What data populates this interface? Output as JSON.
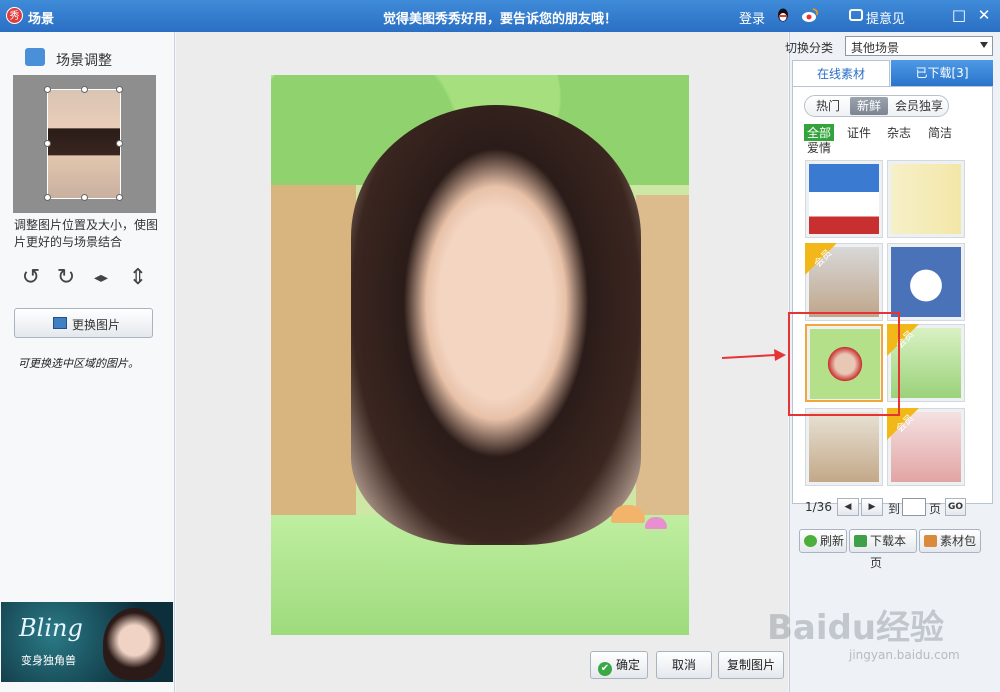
{
  "titlebar": {
    "app_logo": "秀",
    "title": "场景",
    "slogan": "觉得美图秀秀好用，要告诉您的朋友哦！",
    "login": "登录",
    "feedback": "提意见",
    "icons": [
      "qq-icon",
      "weibo-icon",
      "feedback-icon",
      "restore-icon",
      "close-icon"
    ],
    "restore_glyph": "□",
    "close_glyph": "✕"
  },
  "left_panel": {
    "title": "场景调整",
    "help_text": "调整图片位置及大小，使图片更好的与场景结合",
    "tools": [
      "rotate-left-icon",
      "rotate-right-icon",
      "flip-horizontal-icon",
      "flip-vertical-icon"
    ],
    "tool_glyphs": [
      "↺",
      "↻",
      "◂▸",
      "⇕"
    ],
    "change_button": "更换图片",
    "hand_note": "可更换选中区域的图片。",
    "ad": {
      "headline": "Bling",
      "subtitle": "变身独角兽"
    }
  },
  "canvas": {
    "confirm_button": "确定",
    "cancel_button": "取消",
    "copy_button": "复制图片"
  },
  "right_panel": {
    "category_label": "切换分类",
    "category_value": "其他场景",
    "tabs": [
      "在线素材",
      "已下载[3]"
    ],
    "filters": [
      "热门",
      "新鲜",
      "会员独享"
    ],
    "active_filter": "新鲜",
    "sub_categories": [
      "全部",
      "证件",
      "杂志",
      "简洁",
      "爱情"
    ],
    "active_sub_category": "全部",
    "vip_label": "会员",
    "pager": {
      "current": "1/36",
      "prev_glyph": "◀",
      "next_glyph": "▶",
      "goto_label": "到",
      "page_suffix": "页",
      "go": "GO"
    },
    "actions": [
      "刷新",
      "下载本页",
      "素材包"
    ]
  },
  "watermark": {
    "main": "Baidu经验",
    "sub": "jingyan.baidu.com"
  },
  "colors": {
    "titlebar": "#2a6fc4",
    "accent_green": "#33a33c",
    "highlight_red": "#e63434"
  }
}
